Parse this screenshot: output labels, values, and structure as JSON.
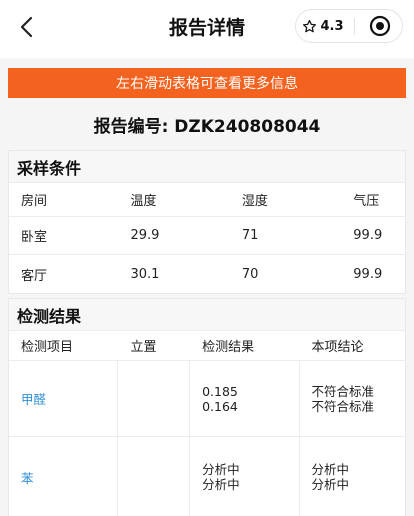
{
  "nav": {
    "title": "报告详情",
    "rating": "4.3"
  },
  "banner": "左右滑动表格可查看更多信息",
  "report": {
    "number_label": "报告编号: DZK240808044"
  },
  "sampling": {
    "title": "采样条件",
    "headers": [
      "房间",
      "温度",
      "湿度",
      "气压"
    ],
    "rows": [
      [
        "卧室",
        "29.9",
        "71",
        "99.9"
      ],
      [
        "客厅",
        "30.1",
        "70",
        "99.9"
      ]
    ]
  },
  "results": {
    "title": "检测结果",
    "headers": [
      "检测项目",
      "立置",
      "检测结果",
      "本项结论"
    ],
    "rows": [
      {
        "item": "甲醛",
        "position": "",
        "values": [
          "0.185",
          "0.164"
        ],
        "conclusions": [
          "不符合标准",
          "不符合标准"
        ]
      },
      {
        "item": "苯",
        "position": "",
        "values": [
          "分析中",
          "分析中"
        ],
        "conclusions": [
          "分析中",
          "分析中"
        ]
      }
    ]
  },
  "colors": {
    "accent": "#f4621f",
    "link": "#2f8fd8"
  }
}
